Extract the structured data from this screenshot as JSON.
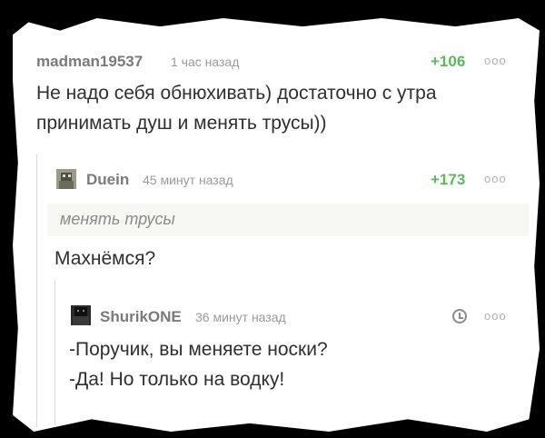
{
  "comments": [
    {
      "username": "madman19537",
      "time": "1 час назад",
      "rating": "+106",
      "menu_dots": "ooo",
      "lines": [
        "Не надо себя обнюхивать) достаточно с утра",
        "принимать душ и менять трусы))"
      ]
    },
    {
      "username": "Duein",
      "time": "45 минут назад",
      "rating": "+173",
      "menu_dots": "ooo",
      "quote": "менять трусы",
      "lines": [
        "Махнёмся?"
      ]
    },
    {
      "username": "ShurikONE",
      "time": "36 минут назад",
      "menu_dots": "ooo",
      "lines": [
        "-Поручик, вы меняете носки?",
        "-Да! Но только на водку!"
      ]
    }
  ],
  "icons": {
    "avatar_duein": "avatar-image",
    "avatar_shurikone": "avatar-image",
    "rating_pending": "clock-icon"
  },
  "colors": {
    "rating_green": "#5cb85c",
    "username_gray": "#7a7a7a",
    "text_dark": "#2f2f2f"
  }
}
